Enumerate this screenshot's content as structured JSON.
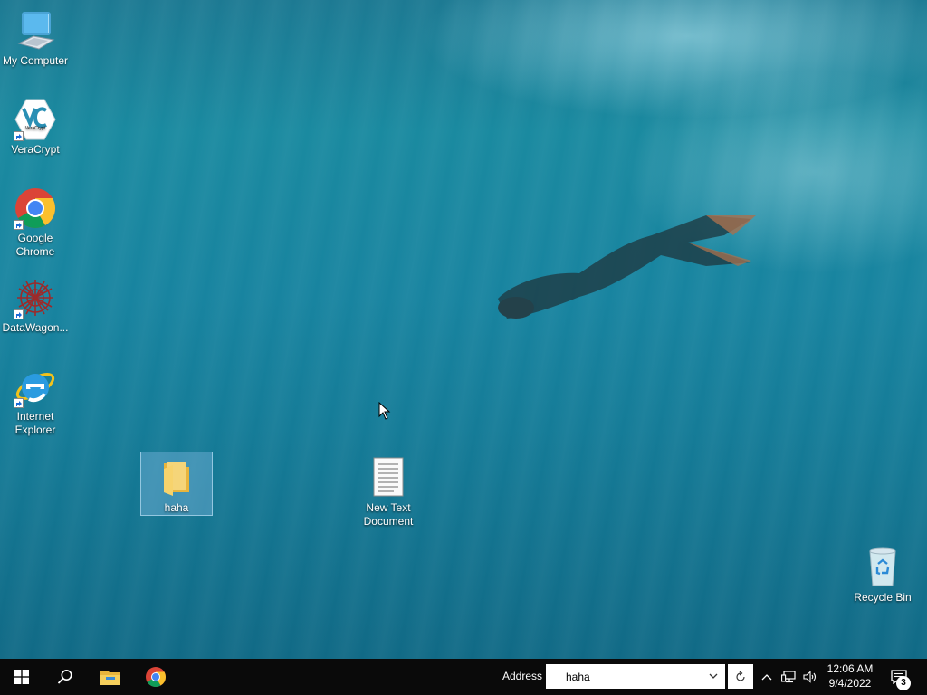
{
  "desktop": {
    "icons": [
      {
        "label": "My Computer",
        "icon": "computer-icon"
      },
      {
        "label": "VeraCrypt",
        "icon": "veracrypt-icon",
        "logo_text": "VeraCrypt"
      },
      {
        "label": "Google Chrome",
        "icon": "chrome-icon"
      },
      {
        "label": "DataWagon...",
        "icon": "datawagon-icon"
      },
      {
        "label": "Internet Explorer",
        "icon": "internet-explorer-icon"
      },
      {
        "label": "haha",
        "icon": "folder-icon",
        "selected": true
      },
      {
        "label": "New Text Document",
        "icon": "text-document-icon"
      },
      {
        "label": "Recycle Bin",
        "icon": "recycle-bin-icon"
      }
    ]
  },
  "taskbar": {
    "address_label": "Address",
    "address_value": "haha",
    "clock_time": "12:06 AM",
    "clock_date": "9/4/2022",
    "notification_count": "3",
    "pinned": [
      "start-icon",
      "search-icon",
      "file-explorer-icon",
      "chrome-icon"
    ],
    "tray": [
      "chevron-up-icon",
      "network-icon",
      "volume-icon",
      "notification-icon"
    ]
  },
  "colors": {
    "taskbar_bg": "#0a0a0a",
    "selection": "#78b4dc"
  }
}
